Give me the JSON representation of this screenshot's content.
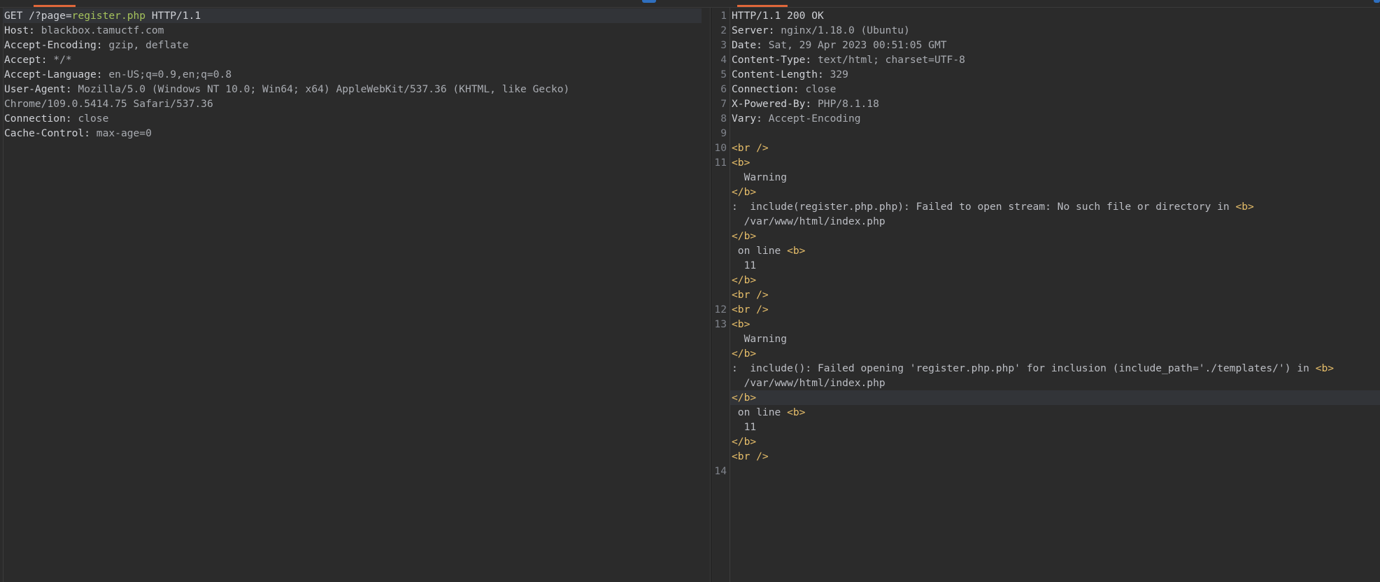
{
  "request": {
    "lines": [
      {
        "method": "GET",
        "path_prefix": " /?page=",
        "path_value": "register.php",
        "proto": " HTTP/1.1"
      },
      {
        "key": "Host:",
        "value": " blackbox.tamuctf.com"
      },
      {
        "key": "Accept-Encoding:",
        "value": " gzip, deflate"
      },
      {
        "key": "Accept:",
        "value": " */*"
      },
      {
        "key": "Accept-Language:",
        "value": " en-US;q=0.9,en;q=0.8"
      },
      {
        "key": "User-Agent:",
        "value": " Mozilla/5.0 (Windows NT 10.0; Win64; x64) AppleWebKit/537.36 (KHTML, like Gecko)"
      },
      {
        "key": "",
        "value": "Chrome/109.0.5414.75 Safari/537.36"
      },
      {
        "key": "Connection:",
        "value": " close"
      },
      {
        "key": "Cache-Control:",
        "value": " max-age=0"
      }
    ]
  },
  "response": {
    "line_numbers": [
      "1",
      "2",
      "3",
      "4",
      "5",
      "6",
      "7",
      "8",
      "9",
      "10",
      "11",
      "12",
      "13",
      "14"
    ],
    "headers": [
      {
        "key": "HTTP/1.1 200 OK",
        "value": ""
      },
      {
        "key": "Server:",
        "value": " nginx/1.18.0 (Ubuntu)"
      },
      {
        "key": "Date:",
        "value": " Sat, 29 Apr 2023 00:51:05 GMT"
      },
      {
        "key": "Content-Type:",
        "value": " text/html; charset=UTF-8"
      },
      {
        "key": "Content-Length:",
        "value": " 329"
      },
      {
        "key": "Connection:",
        "value": " close"
      },
      {
        "key": "X-Powered-By:",
        "value": " PHP/8.1.18"
      },
      {
        "key": "Vary:",
        "value": " Accept-Encoding"
      }
    ],
    "body": [
      {
        "pre": "",
        "tag": "<br />",
        "post": ""
      },
      {
        "pre": "",
        "tag": "<b>",
        "post": ""
      },
      {
        "pre": "  Warning",
        "tag": "",
        "post": ""
      },
      {
        "pre": "",
        "tag": "</b>",
        "post": ""
      },
      {
        "pre": ":  include(register.php.php): Failed to open stream: No such file or directory in ",
        "tag": "<b>",
        "post": ""
      },
      {
        "pre": "  /var/www/html/index.php",
        "tag": "",
        "post": ""
      },
      {
        "pre": "",
        "tag": "</b>",
        "post": ""
      },
      {
        "pre": " on line ",
        "tag": "<b>",
        "post": ""
      },
      {
        "pre": "  11",
        "tag": "",
        "post": ""
      },
      {
        "pre": "",
        "tag": "</b>",
        "post": ""
      },
      {
        "pre": "",
        "tag": "<br />",
        "post": ""
      },
      {
        "pre": "",
        "tag": "<br />",
        "post": ""
      },
      {
        "pre": "",
        "tag": "<b>",
        "post": ""
      },
      {
        "pre": "  Warning",
        "tag": "",
        "post": ""
      },
      {
        "pre": "",
        "tag": "</b>",
        "post": ""
      },
      {
        "pre": ":  include(): Failed opening 'register.php.php' for inclusion (include_path='./templates/') in ",
        "tag": "<b>",
        "post": ""
      },
      {
        "pre": "  /var/www/html/index.php",
        "tag": "",
        "post": ""
      },
      {
        "pre": "",
        "tag": "</b>",
        "post": ""
      },
      {
        "pre": " on line ",
        "tag": "<b>",
        "post": ""
      },
      {
        "pre": "  11",
        "tag": "",
        "post": ""
      },
      {
        "pre": "",
        "tag": "</b>",
        "post": ""
      },
      {
        "pre": "",
        "tag": "<br />",
        "post": ""
      }
    ]
  }
}
